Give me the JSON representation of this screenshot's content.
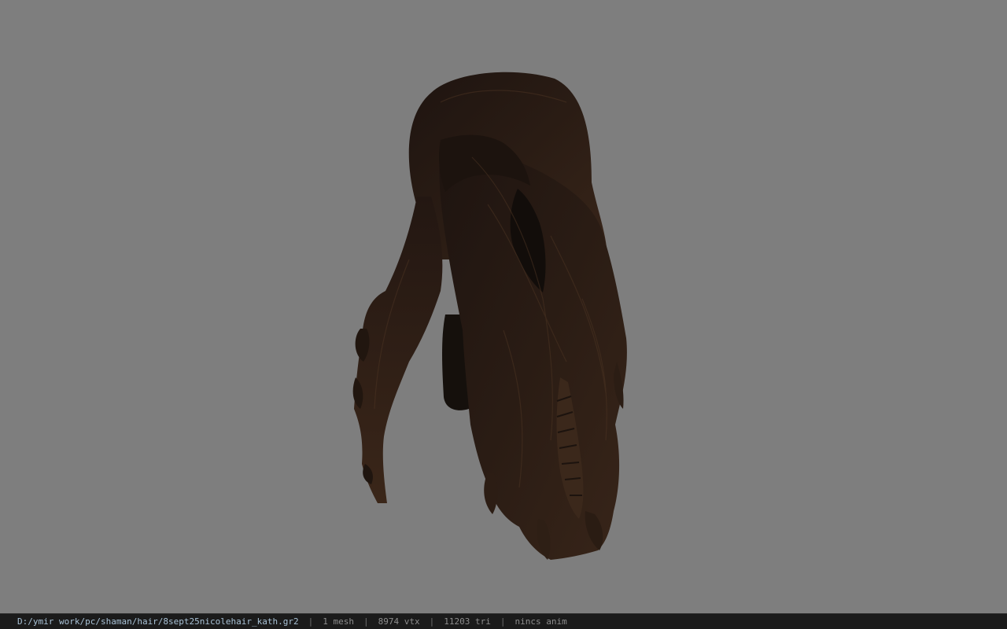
{
  "viewer": {
    "background_color": "#7e7e7e",
    "model_name": "hair-mesh",
    "hair_base_color": "#241812",
    "hair_highlight_color": "#3f2a1c"
  },
  "statusbar": {
    "file_path": "D:/ymir work/pc/shaman/hair/8sept25nicolehair_kath.gr2",
    "separator": "|",
    "mesh_count": "1 mesh",
    "vertex_count": "8974 vtx",
    "triangle_count": "11203 tri",
    "anim_status": "nincs anim"
  }
}
